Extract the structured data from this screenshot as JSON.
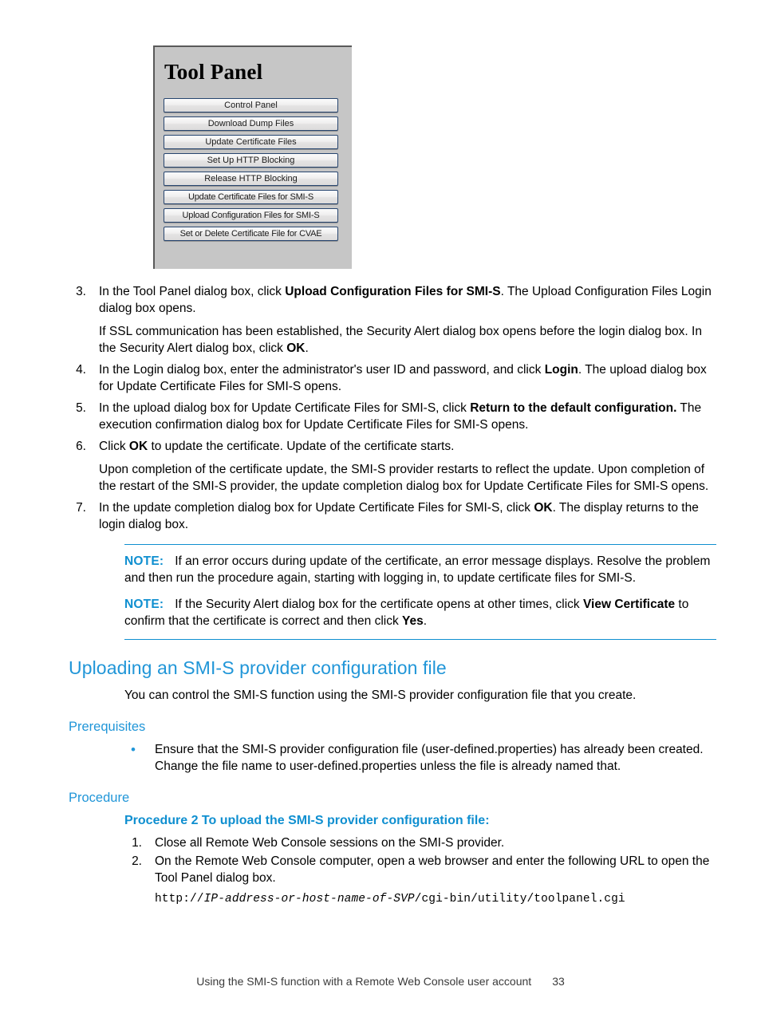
{
  "figure": {
    "title": "Tool Panel",
    "buttons": [
      "Control Panel",
      "Download Dump Files",
      "Update Certificate Files",
      "Set Up HTTP Blocking",
      "Release HTTP Blocking",
      "Update Certificate Files for SMI-S",
      "Upload Configuration Files for SMI-S",
      "Set or Delete Certificate File for CVAE"
    ]
  },
  "steps": [
    {
      "num": "3.",
      "paras": [
        [
          {
            "t": "In the Tool Panel dialog box, click "
          },
          {
            "t": "Upload Configuration Files for SMI-S",
            "b": true
          },
          {
            "t": ". The Upload Configuration Files Login dialog box opens."
          }
        ],
        [
          {
            "t": "If SSL communication has been established, the Security Alert dialog box opens before the login dialog box. In the Security Alert dialog box, click "
          },
          {
            "t": "OK",
            "b": true
          },
          {
            "t": "."
          }
        ]
      ]
    },
    {
      "num": "4.",
      "paras": [
        [
          {
            "t": "In the Login dialog box, enter the administrator's user ID and password, and click "
          },
          {
            "t": "Login",
            "b": true
          },
          {
            "t": ". The upload dialog box for Update Certificate Files for SMI-S opens."
          }
        ]
      ]
    },
    {
      "num": "5.",
      "paras": [
        [
          {
            "t": "In the upload dialog box for Update Certificate Files for SMI-S, click "
          },
          {
            "t": "Return to the default configuration.",
            "b": true
          },
          {
            "t": " The execution confirmation dialog box for Update Certificate Files for SMI-S opens."
          }
        ]
      ]
    },
    {
      "num": "6.",
      "paras": [
        [
          {
            "t": "Click "
          },
          {
            "t": "OK",
            "b": true
          },
          {
            "t": " to update the certificate. Update of the certificate starts."
          }
        ],
        [
          {
            "t": "Upon completion of the certificate update, the SMI-S provider restarts to reflect the update. Upon completion of the restart of the SMI-S provider, the update completion dialog box for Update Certificate Files for SMI-S opens."
          }
        ]
      ]
    },
    {
      "num": "7.",
      "paras": [
        [
          {
            "t": "In the update completion dialog box for Update Certificate Files for SMI-S, click "
          },
          {
            "t": "OK",
            "b": true
          },
          {
            "t": ". The display returns to the login dialog box."
          }
        ]
      ]
    }
  ],
  "notes": [
    {
      "label": "NOTE:",
      "runs": [
        {
          "t": "If an error occurs during update of the certificate, an error message displays. Resolve the problem and then run the procedure again, starting with logging in, to update certificate files for SMI-S."
        }
      ]
    },
    {
      "label": "NOTE:",
      "runs": [
        {
          "t": "If the Security Alert dialog box for the certificate opens at other times, click "
        },
        {
          "t": "View Certificate",
          "b": true
        },
        {
          "t": " to confirm that the certificate is correct and then click "
        },
        {
          "t": "Yes",
          "b": true
        },
        {
          "t": "."
        }
      ]
    }
  ],
  "section": {
    "heading": "Uploading an SMI-S provider configuration file",
    "intro": "You can control the SMI-S function using the SMI-S provider configuration file that you create.",
    "prerequisites_heading": "Prerequisites",
    "prerequisites_items": [
      "Ensure that the SMI-S provider configuration file (user-defined.properties) has already been created. Change the file name to user-defined.properties unless the file is already named that."
    ],
    "procedure_heading": "Procedure",
    "procedure_title": "Procedure 2 To upload the SMI-S provider configuration file:",
    "procedure_steps": [
      {
        "num": "1.",
        "text": "Close all Remote Web Console sessions on the SMI-S provider."
      },
      {
        "num": "2.",
        "text": "On the Remote Web Console computer, open a web browser and enter the following URL to open the Tool Panel dialog box."
      }
    ],
    "url": {
      "prefix": "http://",
      "italic": "IP-address-or-host-name-of-SVP",
      "suffix": "/cgi-bin/utility/toolpanel.cgi"
    }
  },
  "footer": {
    "text": "Using the SMI-S function with a Remote Web Console user account",
    "page": "33"
  },
  "colors": {
    "heading_blue": "#2196d8",
    "note_blue": "#0f8fd0",
    "bullet_blue": "#2196d8",
    "panel_gray": "#c6c6c6",
    "button_border": "#27456f"
  }
}
